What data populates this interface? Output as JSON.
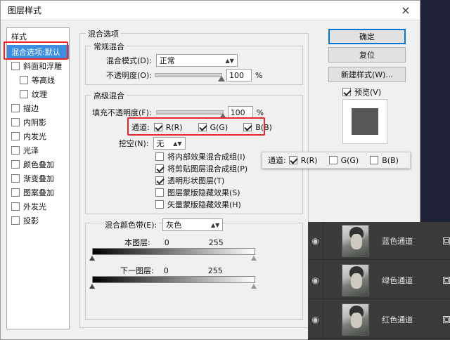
{
  "dialog": {
    "title": "图层样式",
    "close_label": "×"
  },
  "styles_panel": {
    "header": "样式",
    "items": [
      {
        "label": "混合选项:默认",
        "selected": true,
        "checkbox": false,
        "checked": false
      },
      {
        "label": "斜面和浮雕",
        "checkbox": true,
        "checked": false
      },
      {
        "label": "等高线",
        "checkbox": true,
        "checked": false,
        "indent": true
      },
      {
        "label": "纹理",
        "checkbox": true,
        "checked": false,
        "indent": true
      },
      {
        "label": "描边",
        "checkbox": true,
        "checked": false
      },
      {
        "label": "内阴影",
        "checkbox": true,
        "checked": false
      },
      {
        "label": "内发光",
        "checkbox": true,
        "checked": false
      },
      {
        "label": "光泽",
        "checkbox": true,
        "checked": false
      },
      {
        "label": "颜色叠加",
        "checkbox": true,
        "checked": false
      },
      {
        "label": "渐变叠加",
        "checkbox": true,
        "checked": false
      },
      {
        "label": "图案叠加",
        "checkbox": true,
        "checked": false
      },
      {
        "label": "外发光",
        "checkbox": true,
        "checked": false
      },
      {
        "label": "投影",
        "checkbox": true,
        "checked": false
      }
    ]
  },
  "blend_options": {
    "title": "混合选项",
    "general": {
      "title": "常规混合",
      "mode_label": "混合模式(D):",
      "mode_value": "正常",
      "opacity_label": "不透明度(O):",
      "opacity_value": "100",
      "opacity_unit": "%",
      "opacity_level": 1.0
    },
    "advanced": {
      "title": "高级混合",
      "fill_label": "填充不透明度(F):",
      "fill_value": "100",
      "fill_unit": "%",
      "fill_level": 1.0,
      "channels_label": "通道:",
      "channels": [
        {
          "label": "R(R)",
          "checked": true
        },
        {
          "label": "G(G)",
          "checked": true
        },
        {
          "label": "B(B)",
          "checked": true
        }
      ],
      "knockout_label": "挖空(N):",
      "knockout_value": "无",
      "options": [
        {
          "label": "将内部效果混合成组(I)",
          "checked": false
        },
        {
          "label": "将剪贴图层混合成组(P)",
          "checked": true
        },
        {
          "label": "透明形状图层(T)",
          "checked": true
        },
        {
          "label": "图层蒙版隐藏效果(S)",
          "checked": false
        },
        {
          "label": "矢量蒙版隐藏效果(H)",
          "checked": false
        }
      ]
    },
    "blend_if": {
      "label": "混合颜色带(E):",
      "value": "灰色",
      "this_layer_label": "本图层:",
      "this_layer_min": "0",
      "this_layer_max": "255",
      "underlying_label": "下一图层:",
      "underlying_min": "0",
      "underlying_max": "255"
    }
  },
  "buttons": {
    "ok": "确定",
    "reset": "复位",
    "new_style": "新建样式(W)...",
    "preview_label": "预览(V)",
    "preview_checked": true
  },
  "overlay_channels": {
    "label": "通道:",
    "items": [
      {
        "label": "R(R)",
        "checked": true
      },
      {
        "label": "G(G)",
        "checked": false
      },
      {
        "label": "B(B)",
        "checked": false
      }
    ]
  },
  "channels_panel": {
    "rows": [
      {
        "name": "蓝色通道"
      },
      {
        "name": "绿色通道"
      },
      {
        "name": "红色通道"
      }
    ]
  },
  "colors": {
    "selection": "#3d8ee0",
    "highlight": "#e8242c",
    "panel_dark": "#3b3b3b"
  }
}
